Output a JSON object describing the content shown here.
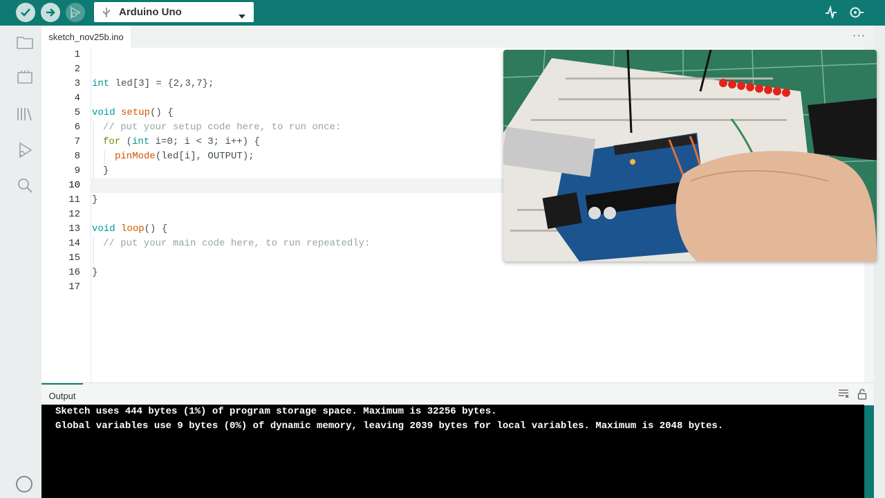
{
  "toolbar": {
    "board_name": "Arduino Uno",
    "verify_icon": "check-icon",
    "upload_icon": "arrow-right-icon",
    "debug_icon": "debug-icon",
    "plotter_icon": "serial-plotter-icon",
    "monitor_icon": "serial-monitor-icon"
  },
  "tabs": [
    {
      "label": "sketch_nov25b.ino"
    }
  ],
  "editor": {
    "line_numbers": [
      "1",
      "2",
      "3",
      "4",
      "5",
      "6",
      "7",
      "8",
      "9",
      "10",
      "11",
      "12",
      "13",
      "14",
      "15",
      "16",
      "17"
    ],
    "active_line": 10,
    "code": {
      "l3_a": "int",
      "l3_b": " led[3] = {2,3,7};",
      "l5_a": "void",
      "l5_b": " ",
      "l5_c": "setup",
      "l5_d": "() {",
      "l6": "// put your setup code here, to run once:",
      "l7_a": "for",
      "l7_b": " (",
      "l7_c": "int",
      "l7_d": " i=0; i < 3; i++) {",
      "l8_a": "pinMode",
      "l8_b": "(led[i], OUTPUT);",
      "l9": "}",
      "l11": "}",
      "l13_a": "void",
      "l13_b": " ",
      "l13_c": "loop",
      "l13_d": "() {",
      "l14": "// put your main code here, to run repeatedly:",
      "l16": "}"
    }
  },
  "output": {
    "tab_label": "Output",
    "lines": [
      "Sketch uses 444 bytes (1%) of program storage space. Maximum is 32256 bytes.",
      "Global variables use 9 bytes (0%) of dynamic memory, leaving 2039 bytes for local variables. Maximum is 2048 bytes."
    ]
  },
  "colors": {
    "accent": "#0e7a73",
    "keyword": "#00979d",
    "function": "#d35400"
  }
}
